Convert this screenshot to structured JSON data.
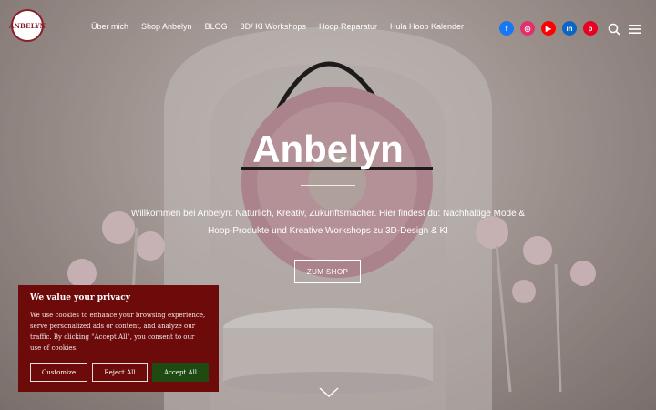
{
  "site": {
    "logo_text": "ANBELYN",
    "nav": [
      "Über mich",
      "Shop Anbelyn",
      "BLOG",
      "3D/ KI Workshops",
      "Hoop Reparatur",
      "Hula Hoop Kalender"
    ],
    "social": [
      {
        "name": "facebook-icon",
        "glyph": "f",
        "color": "#1877f2"
      },
      {
        "name": "instagram-icon",
        "glyph": "◎",
        "color": "#e1306c"
      },
      {
        "name": "youtube-icon",
        "glyph": "▶",
        "color": "#ff0000"
      },
      {
        "name": "linkedin-icon",
        "glyph": "in",
        "color": "#0a66c2"
      },
      {
        "name": "pinterest-icon",
        "glyph": "p",
        "color": "#e60023"
      }
    ]
  },
  "hero": {
    "title": "Anbelyn",
    "subtitle_line1": "Willkommen bei Anbelyn: Natürlich, Kreativ, Zukunftsmacher. Hier findest du: Nachhaltige Mode &",
    "subtitle_line2": "Hoop-Produkte und Kreative Workshops zu 3D-Design & KI",
    "cta": "ZUM SHOP"
  },
  "cookie": {
    "title": "We value your privacy",
    "text": "We use cookies to enhance your browsing experience, serve personalized ads or content, and analyze our traffic. By clicking \"Accept All\", you consent to our use of cookies.",
    "customize": "Customize",
    "reject": "Reject All",
    "accept": "Accept All"
  }
}
